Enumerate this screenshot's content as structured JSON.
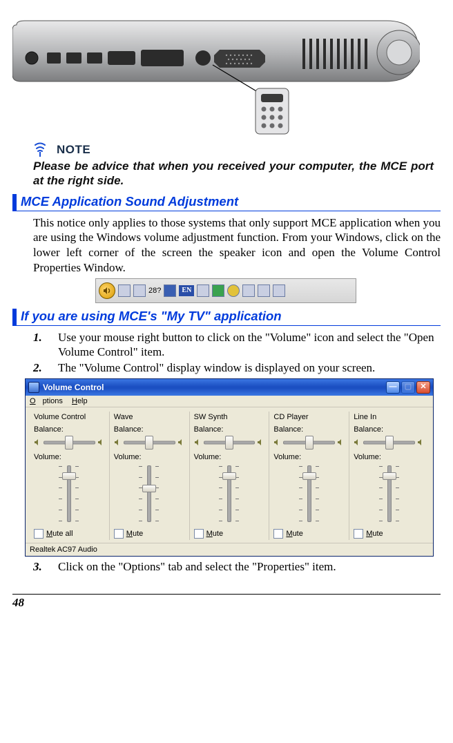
{
  "note": {
    "label": "NOTE",
    "text": "Please be advice that when you received your computer, the MCE port at the right side."
  },
  "section1": {
    "title": "MCE Application Sound Adjustment",
    "paragraph": "This notice only applies to those systems that only support MCE application when you are using the Windows volume adjustment function. From your Windows, click on the lower left corner of the screen the speaker icon and open the Volume Control Properties Window."
  },
  "systray": {
    "clock_text": "28?",
    "ime_text": "EN"
  },
  "section2": {
    "title": "If you are using MCE's \"My TV\" application",
    "steps": [
      "Use your mouse right button to click on the \"Volume\" icon and select the \"Open Volume Control\" item.",
      "The \"Volume Control\" display window is displayed on your screen."
    ],
    "step3": "Click on the \"Options\" tab and select the \"Properties\" item."
  },
  "volumeControl": {
    "title": "Volume Control",
    "menu": {
      "options": "Options",
      "help": "Help"
    },
    "columns": [
      {
        "name": "Volume Control",
        "balance": "Balance:",
        "volume": "Volume:",
        "mute": "Mute all",
        "thumb_pct": 12
      },
      {
        "name": "Wave",
        "balance": "Balance:",
        "volume": "Volume:",
        "mute": "Mute",
        "thumb_pct": 34
      },
      {
        "name": "SW Synth",
        "balance": "Balance:",
        "volume": "Volume:",
        "mute": "Mute",
        "thumb_pct": 12
      },
      {
        "name": "CD Player",
        "balance": "Balance:",
        "volume": "Volume:",
        "mute": "Mute",
        "thumb_pct": 12
      },
      {
        "name": "Line In",
        "balance": "Balance:",
        "volume": "Volume:",
        "mute": "Mute",
        "thumb_pct": 12
      }
    ],
    "status": "Realtek AC97 Audio"
  },
  "pageNumber": "48"
}
